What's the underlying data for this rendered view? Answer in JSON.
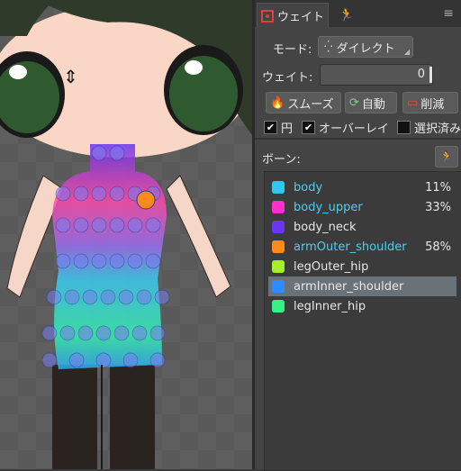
{
  "panel": {
    "tab_label": "ウェイト",
    "mode_label": "モード:",
    "mode_value": "ダイレクト",
    "weight_label": "ウェイト:",
    "weight_value": "0",
    "buttons": [
      "スムーズ",
      "自動",
      "削減"
    ],
    "checkboxes": [
      {
        "label": "円",
        "checked": true
      },
      {
        "label": "オーバーレイ",
        "checked": true
      },
      {
        "label": "選択済み",
        "checked": false
      }
    ],
    "bones_label": "ボーン:"
  },
  "bones": [
    {
      "name": "body",
      "percent": "11%",
      "color": "#2fc8f0",
      "highlight": true
    },
    {
      "name": "body_upper",
      "percent": "33%",
      "color": "#ff2fc8",
      "highlight": true
    },
    {
      "name": "body_neck",
      "percent": "",
      "color": "#6a36f0",
      "highlight": false
    },
    {
      "name": "armOuter_shoulder",
      "percent": "58%",
      "color": "#ff8a1a",
      "highlight": true
    },
    {
      "name": "legOuter_hip",
      "percent": "",
      "color": "#a6f02a",
      "highlight": false
    },
    {
      "name": "armInner_shoulder",
      "percent": "",
      "color": "#2f8cff",
      "highlight": false,
      "selected": true
    },
    {
      "name": "legInner_hip",
      "percent": "",
      "color": "#36f08a",
      "highlight": false
    }
  ]
}
